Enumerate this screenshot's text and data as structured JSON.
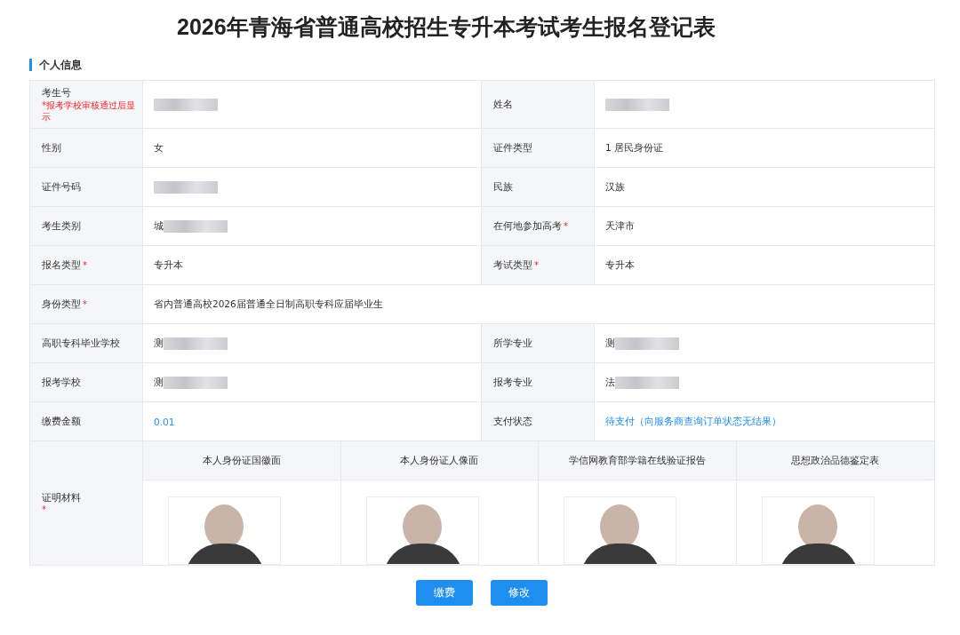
{
  "title": "2026年青海省普通高校招生专升本考试考生报名登记表",
  "section": {
    "title": "个人信息"
  },
  "rows": [
    [
      {
        "label": "考生号",
        "note": "*报考学校审核通过后显示",
        "kind": "masked"
      },
      {
        "label": "姓名",
        "kind": "masked"
      }
    ],
    [
      {
        "label": "性别",
        "value": "女",
        "kind": "plain"
      },
      {
        "label": "证件类型",
        "value": "1 居民身份证",
        "kind": "plain"
      }
    ],
    [
      {
        "label": "证件号码",
        "kind": "masked"
      },
      {
        "label": "民族",
        "value": "汉族",
        "kind": "plain"
      }
    ],
    [
      {
        "label": "考生类别",
        "value": "城",
        "kind": "masked"
      },
      {
        "label": "在何地参加高考",
        "mark": "*",
        "value": "天津市",
        "kind": "plain"
      }
    ],
    [
      {
        "label": "报名类型",
        "mark": "*",
        "value": "专升本",
        "kind": "plain"
      },
      {
        "label": "考试类型",
        "mark": "*",
        "value": "专升本",
        "kind": "plain"
      }
    ],
    [
      {
        "label": "身份类型",
        "mark": "*",
        "value": "省内普通高校2026届普通全日制高职专科应届毕业生",
        "kind": "plain"
      }
    ],
    [
      {
        "label": "高职专科毕业学校",
        "value": "测",
        "kind": "masked"
      },
      {
        "label": "所学专业",
        "value": "测",
        "kind": "masked"
      }
    ],
    [
      {
        "label": "报考学校",
        "value": "测",
        "kind": "masked"
      },
      {
        "label": "报考专业",
        "value": "法",
        "kind": "masked"
      }
    ],
    [
      {
        "label": "缴费金额",
        "value": "0.01",
        "kind": "link"
      },
      {
        "label": "支付状态",
        "value": "待支付（向服务商查询订单状态无结果）",
        "kind": "link"
      }
    ]
  ],
  "materials": {
    "label": "证明材料",
    "mark": "*",
    "items": [
      {
        "caption": "本人身份证国徽面"
      },
      {
        "caption": "本人身份证人像面"
      },
      {
        "caption": "学信网教育部学籍在线验证报告"
      },
      {
        "caption": "思想政治品德鉴定表"
      }
    ]
  },
  "buttons": [
    "缴费",
    "修改"
  ]
}
